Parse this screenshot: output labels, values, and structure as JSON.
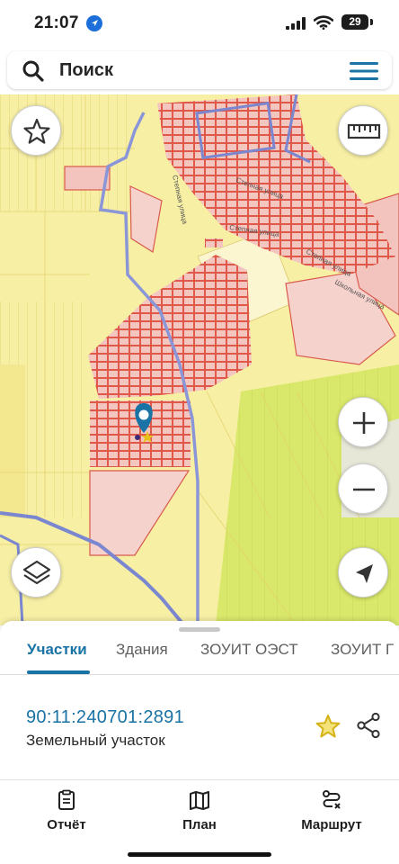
{
  "status_bar": {
    "time": "21:07",
    "battery": "29"
  },
  "search": {
    "placeholder": "Поиск"
  },
  "icons": {
    "search": "search-icon",
    "menu": "hamburger-menu-icon",
    "favorite": "star-outline-icon",
    "ruler": "ruler-icon",
    "zoom_in": "plus-icon",
    "zoom_out": "minus-icon",
    "layers": "layers-icon",
    "locate": "navigation-arrow-icon",
    "pin": "map-pin-icon"
  },
  "map": {
    "street_labels": [
      "Степная улица",
      "Степная улица",
      "Степная улица",
      "Школьная улица",
      "Степная улица"
    ]
  },
  "sheet": {
    "tabs": [
      {
        "label": "Участки",
        "active": true
      },
      {
        "label": "Здания",
        "active": false
      },
      {
        "label": "ЗОУИТ ОЭСТ",
        "active": false
      },
      {
        "label": "ЗОУИТ Г",
        "active": false
      }
    ],
    "parcel": {
      "number": "90:11:240701:2891",
      "type": "Земельный участок"
    }
  },
  "bottom_nav": [
    {
      "label": "Отчёт",
      "icon": "report-icon"
    },
    {
      "label": "План",
      "icon": "map-plan-icon"
    },
    {
      "label": "Маршрут",
      "icon": "route-icon"
    }
  ],
  "colors": {
    "accent": "#1a73a5",
    "map_yellow": "#f7efa4",
    "map_green": "#d9e86a",
    "parcel_fill": "#f4c6c0",
    "parcel_stroke": "#e0584a",
    "boundary_blue": "#7a86cf",
    "star_gold": "#d6b21a"
  }
}
